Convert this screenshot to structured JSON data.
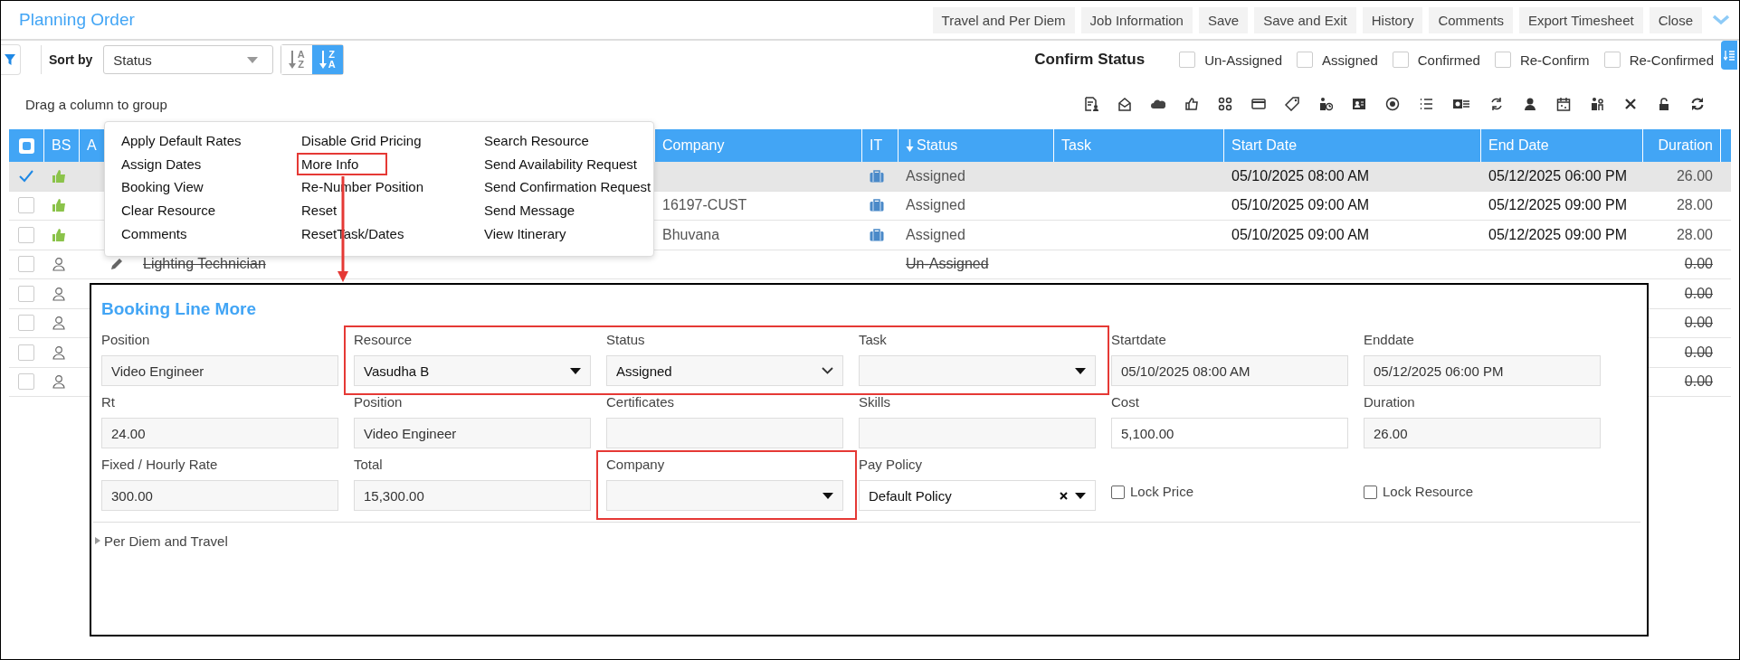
{
  "window": {
    "title": "Planning Order"
  },
  "top_actions": [
    "Travel and Per Diem",
    "Job Information",
    "Save",
    "Save and Exit",
    "History",
    "Comments",
    "Export Timesheet",
    "Close"
  ],
  "toolbar": {
    "sort_label": "Sort by",
    "sort_field": "Status",
    "sort_buttons": [
      {
        "top": "A",
        "bottom": "Z",
        "selected": false
      },
      {
        "top": "Z",
        "bottom": "A",
        "selected": true
      }
    ],
    "confirm_label": "Confirm Status",
    "confirm_options": [
      {
        "label": "Un-Assigned",
        "checked": false
      },
      {
        "label": "Assigned",
        "checked": false
      },
      {
        "label": "Confirmed",
        "checked": false
      },
      {
        "label": "Re-Confirm",
        "checked": false
      },
      {
        "label": "Re-Confirmed",
        "checked": false
      }
    ]
  },
  "group_hint": "Drag a column to group",
  "table": {
    "header_checkbox": {
      "indeterminate": true
    },
    "columns": [
      {
        "label": "BS",
        "sorted": false
      },
      {
        "label": "A",
        "sorted": false
      },
      {
        "label": "Company",
        "sorted": false
      },
      {
        "label": "IT",
        "sorted": false
      },
      {
        "label": "Status",
        "sorted": true
      },
      {
        "label": "Task",
        "sorted": false
      },
      {
        "label": "Start Date",
        "sorted": false
      },
      {
        "label": "End Date",
        "sorted": false
      },
      {
        "label": "Duration",
        "sorted": false
      }
    ],
    "rows": [
      {
        "checked": true,
        "selected": true,
        "kind": "booked",
        "struck": false,
        "edit": false,
        "it": true,
        "status": "Assigned",
        "start": "05/10/2025 08:00 AM",
        "end": "05/12/2025 06:00 PM",
        "duration": "26.00"
      },
      {
        "checked": false,
        "selected": false,
        "kind": "booked",
        "struck": false,
        "edit": false,
        "company": "16197-CUST",
        "it": true,
        "status": "Assigned",
        "start": "05/10/2025 09:00 AM",
        "end": "05/12/2025 09:00 PM",
        "duration": "28.00"
      },
      {
        "checked": false,
        "selected": false,
        "kind": "booked",
        "struck": false,
        "edit": false,
        "company": "Bhuvana",
        "it": true,
        "status": "Assigned",
        "start": "05/10/2025 09:00 AM",
        "end": "05/12/2025 09:00 PM",
        "duration": "28.00"
      },
      {
        "checked": false,
        "selected": false,
        "kind": "open",
        "struck": true,
        "edit": true,
        "position": "Lighting Technician",
        "it": false,
        "status": "Un-Assigned",
        "duration": "0.00"
      },
      {
        "checked": false,
        "selected": false,
        "kind": "open",
        "struck": true,
        "edit": false,
        "it": false,
        "duration": "0.00"
      },
      {
        "checked": false,
        "selected": false,
        "kind": "open",
        "struck": true,
        "edit": false,
        "it": false,
        "duration": "0.00"
      },
      {
        "checked": false,
        "selected": false,
        "kind": "open",
        "struck": true,
        "edit": false,
        "it": false,
        "duration": "0.00"
      },
      {
        "checked": false,
        "selected": false,
        "kind": "open",
        "struck": true,
        "edit": false,
        "it": false,
        "duration": "0.00"
      }
    ]
  },
  "context_menu": {
    "items": [
      {
        "label": "Apply Default Rates",
        "marked": false
      },
      {
        "label": "Assign Dates",
        "marked": false
      },
      {
        "label": "Booking View",
        "marked": false
      },
      {
        "label": "Clear Resource",
        "marked": false
      },
      {
        "label": "Comments",
        "marked": false
      },
      {
        "label": "Disable Grid Pricing",
        "marked": false
      },
      {
        "label": "More Info",
        "marked": true
      },
      {
        "label": "Re-Number Position",
        "marked": false
      },
      {
        "label": "Reset",
        "marked": false
      },
      {
        "label": "ResetTask/Dates",
        "marked": false
      },
      {
        "label": "Search Resource",
        "marked": false
      },
      {
        "label": "Send Availability Request",
        "marked": false
      },
      {
        "label": "Send Confirmation Request",
        "marked": false
      },
      {
        "label": "Send Message",
        "marked": false
      },
      {
        "label": "View Itinerary",
        "marked": false
      }
    ]
  },
  "panel": {
    "title": "Booking Line More",
    "rows": [
      [
        {
          "kind": "readonly",
          "label": "Position",
          "value": "Video Engineer",
          "marked": false
        },
        {
          "kind": "dropdown",
          "label": "Resource",
          "value": "Vasudha B",
          "marked": true
        },
        {
          "kind": "select",
          "label": "Status",
          "value": "Assigned",
          "marked": true
        },
        {
          "kind": "dropdown",
          "label": "Task",
          "marked": true
        },
        {
          "kind": "readonly",
          "label": "Startdate",
          "value": "05/10/2025 08:00 AM",
          "marked": false
        },
        {
          "kind": "readonly",
          "label": "Enddate",
          "value": "05/12/2025 06:00 PM",
          "marked": false
        }
      ],
      [
        {
          "kind": "readonly",
          "label": "Rt",
          "value": "24.00",
          "marked": false
        },
        {
          "kind": "readonly",
          "label": "Position",
          "value": "Video Engineer",
          "marked": false
        },
        {
          "kind": "readonly",
          "label": "Certificates",
          "marked": false
        },
        {
          "kind": "readonly",
          "label": "Skills",
          "marked": false
        },
        {
          "kind": "input",
          "label": "Cost",
          "value": "5,100.00",
          "marked": false
        },
        {
          "kind": "readonly",
          "label": "Duration",
          "value": "26.00",
          "marked": false
        }
      ],
      [
        {
          "kind": "readonly",
          "label": "Fixed / Hourly Rate",
          "value": "300.00",
          "marked": false
        },
        {
          "kind": "readonly",
          "label": "Total",
          "value": "15,300.00",
          "marked": false
        },
        {
          "kind": "dropdown",
          "label": "Company",
          "marked": true
        },
        {
          "kind": "combo",
          "label": "Pay Policy",
          "value": "Default Policy",
          "marked": false
        },
        {
          "kind": "checkbox",
          "label": "Lock Price",
          "checked": false,
          "marked": false
        },
        {
          "kind": "checkbox",
          "label": "Lock Resource",
          "checked": false,
          "marked": false
        }
      ]
    ],
    "section": {
      "label": "Per Diem and Travel",
      "expanded": false
    }
  }
}
